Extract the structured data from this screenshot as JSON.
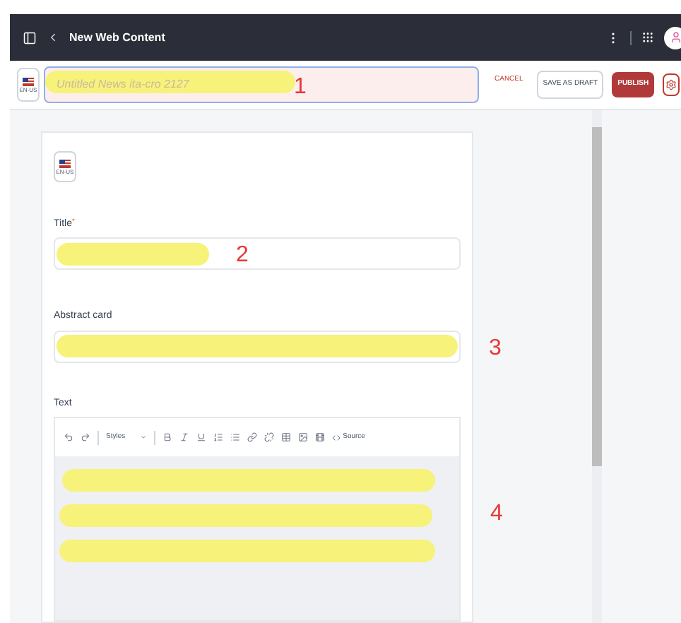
{
  "header": {
    "title": "New Web Content"
  },
  "title_bar": {
    "locale": "EN-US",
    "placeholder": "Untitled News ita-cro 2127",
    "marker": "1",
    "actions": [
      {
        "label": "CANCEL",
        "kind": "link"
      },
      {
        "label": "SAVE AS DRAFT",
        "kind": "secondary"
      },
      {
        "label": "PUBLISH",
        "kind": "primary"
      }
    ]
  },
  "form": {
    "locale": "EN-US",
    "fields": [
      {
        "label": "Title",
        "required_mark": "*",
        "marker": "2"
      },
      {
        "label": "Abstract card",
        "marker": "3"
      }
    ],
    "text_editor": {
      "label": "Text",
      "styles": "Styles",
      "source": "Source",
      "marker": "4"
    }
  }
}
